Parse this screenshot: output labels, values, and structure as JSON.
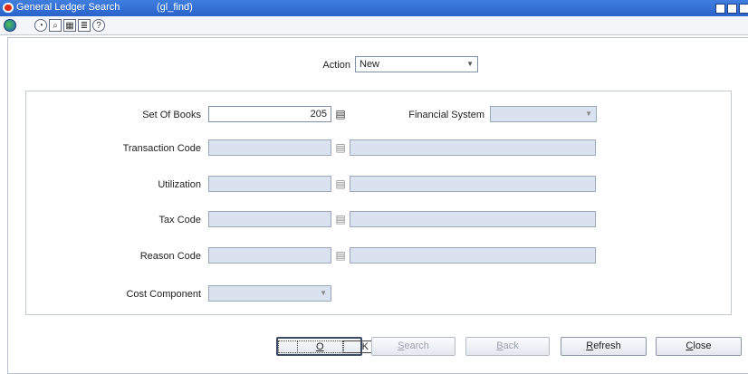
{
  "window": {
    "title": "General Ledger Search",
    "form_code": "(gl_find)"
  },
  "toolbar": {
    "icons": [
      "globe-icon",
      "help-icon",
      "search-icon",
      "calendar-icon",
      "notes-icon",
      "info-icon"
    ]
  },
  "action": {
    "label": "Action",
    "value": "New"
  },
  "fields": {
    "set_of_books": {
      "label": "Set Of Books",
      "value": "205"
    },
    "financial_system": {
      "label": "Financial System",
      "value": ""
    },
    "transaction_code": {
      "label": "Transaction Code",
      "value": ""
    },
    "utilization": {
      "label": "Utilization",
      "value": ""
    },
    "tax_code": {
      "label": "Tax Code",
      "value": ""
    },
    "reason_code": {
      "label": "Reason Code",
      "value": ""
    },
    "cost_component": {
      "label": "Cost Component",
      "value": ""
    }
  },
  "buttons": {
    "ok": {
      "label": "OK",
      "mnemonic": "O",
      "rest": "K"
    },
    "search": {
      "label": "Search",
      "mnemonic": "S",
      "rest": "earch"
    },
    "back": {
      "label": "Back",
      "mnemonic": "B",
      "rest": "ack"
    },
    "refresh": {
      "label": "Refresh",
      "mnemonic": "R",
      "rest": "efresh"
    },
    "close": {
      "label": "Close",
      "mnemonic": "C",
      "rest": "lose"
    }
  },
  "colors": {
    "titlebar": "#2a62c9",
    "disabled_field": "#d9e2ee",
    "panel_border": "#c3cad4"
  }
}
